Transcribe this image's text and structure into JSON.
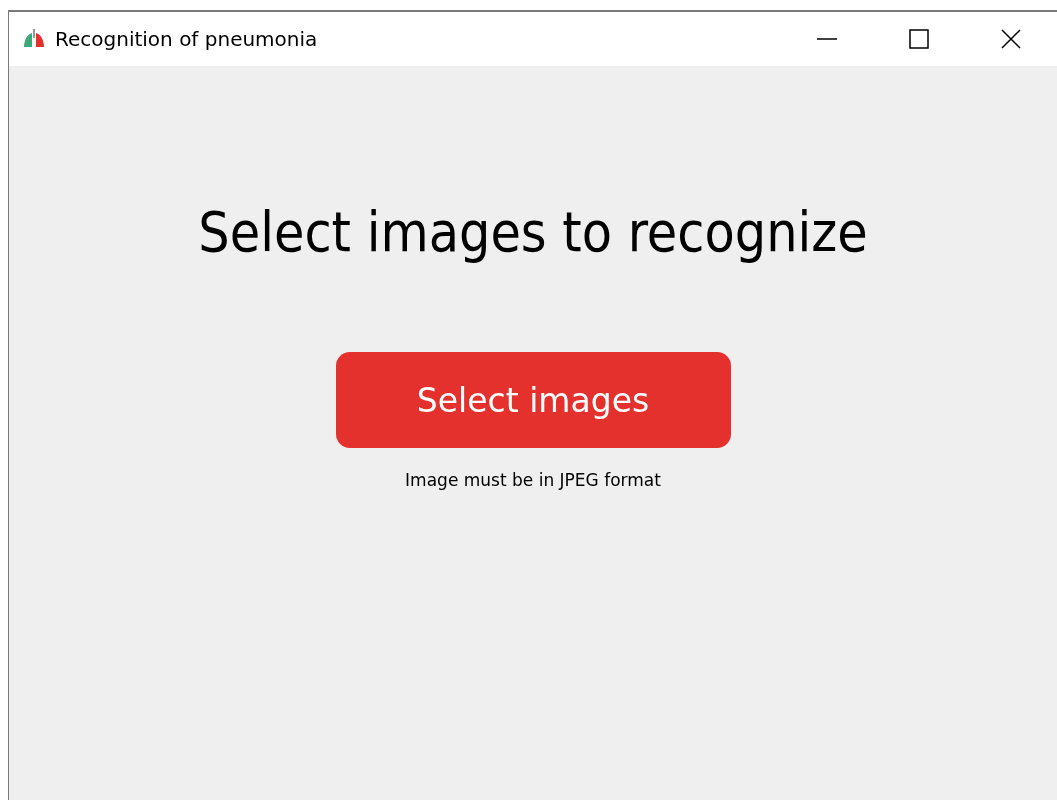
{
  "window": {
    "title": "Recognition of pneumonia"
  },
  "heading": "Select images to recognize",
  "select_button": {
    "label": "Select images"
  },
  "hint": "Image must be in JPEG format"
}
